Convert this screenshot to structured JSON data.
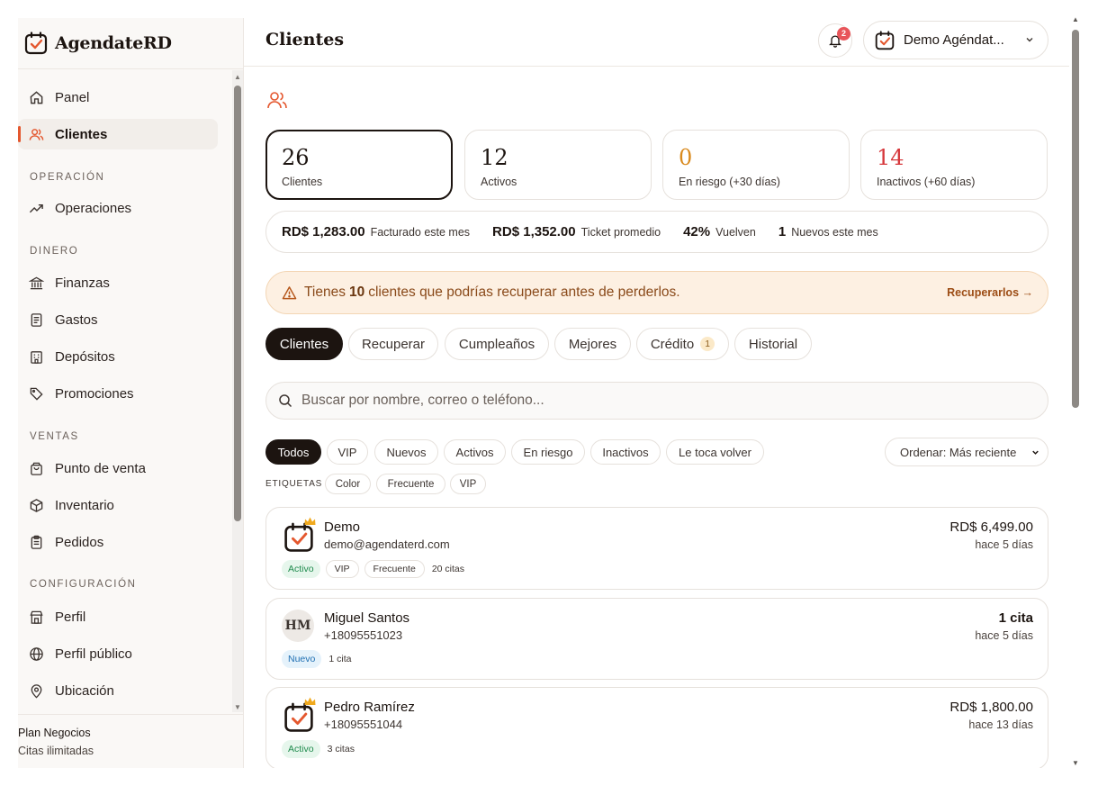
{
  "app": {
    "name": "AgendateRD"
  },
  "sidebar": {
    "items": [
      {
        "label": "Panel"
      },
      {
        "label": "Clientes"
      },
      {
        "label": "Operaciones"
      },
      {
        "label": "Finanzas"
      },
      {
        "label": "Gastos"
      },
      {
        "label": "Depósitos"
      },
      {
        "label": "Promociones"
      },
      {
        "label": "Punto de venta"
      },
      {
        "label": "Inventario"
      },
      {
        "label": "Pedidos"
      },
      {
        "label": "Perfil"
      },
      {
        "label": "Perfil público"
      },
      {
        "label": "Ubicación"
      }
    ],
    "sections": [
      "OPERACIÓN",
      "DINERO",
      "VENTAS",
      "CONFIGURACIÓN"
    ],
    "plan": {
      "name": "Plan Negocios",
      "sub": "Citas ilimitadas"
    }
  },
  "header": {
    "title": "Clientes",
    "notifications": "2",
    "account": "Demo Agéndat..."
  },
  "stats": [
    {
      "value": "26",
      "label": "Clientes",
      "color": "#1c1410"
    },
    {
      "value": "12",
      "label": "Activos",
      "color": "#1c1410"
    },
    {
      "value": "0",
      "label": "En riesgo (+30 días)",
      "color": "#d98a1e"
    },
    {
      "value": "14",
      "label": "Inactivos (+60 días)",
      "color": "#d6373b"
    }
  ],
  "summary": [
    {
      "value": "RD$ 1,283.00",
      "label": "Facturado este mes"
    },
    {
      "value": "RD$ 1,352.00",
      "label": "Ticket promedio"
    },
    {
      "value": "42%",
      "label": "Vuelven"
    },
    {
      "value": "1",
      "label": "Nuevos este mes"
    }
  ],
  "alert": {
    "prefix": "Tienes",
    "count": "10",
    "suffix": "clientes que podrías recuperar antes de perderlos.",
    "link": "Recuperarlos →"
  },
  "tabs": [
    {
      "label": "Clientes"
    },
    {
      "label": "Recuperar"
    },
    {
      "label": "Cumpleaños"
    },
    {
      "label": "Mejores"
    },
    {
      "label": "Crédito",
      "badge": "1"
    },
    {
      "label": "Historial"
    }
  ],
  "search": {
    "placeholder": "Buscar por nombre, correo o teléfono..."
  },
  "filters": [
    "Todos",
    "VIP",
    "Nuevos",
    "Activos",
    "En riesgo",
    "Inactivos",
    "Le toca volver"
  ],
  "sort": {
    "label": "Ordenar: Más reciente"
  },
  "tags": {
    "label": "ETIQUETAS",
    "items": [
      "Color",
      "Frecuente",
      "VIP"
    ]
  },
  "clients": [
    {
      "name": "Demo",
      "contact": "demo@agendaterd.com",
      "value": "RD$ 6,499.00",
      "when": "hace 5 días",
      "status": "Activo",
      "tags": [
        "VIP",
        "Frecuente"
      ],
      "count": "20 citas"
    },
    {
      "name": "Miguel Santos",
      "initials": "HM",
      "contact": "+18095551023",
      "value": "1 cita",
      "when": "hace 5 días",
      "status": "Nuevo",
      "count": "1 cita"
    },
    {
      "name": "Pedro Ramírez",
      "contact": "+18095551044",
      "value": "RD$ 1,800.00",
      "when": "hace 13 días",
      "status": "Activo",
      "count": "3 citas"
    }
  ]
}
